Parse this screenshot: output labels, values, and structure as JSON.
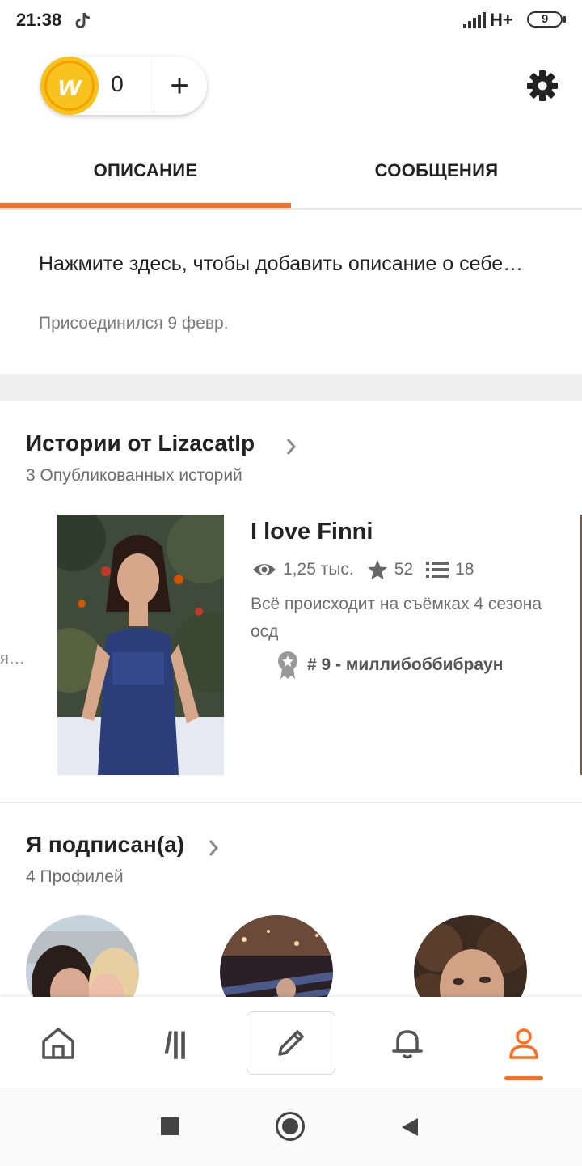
{
  "status_bar": {
    "time": "21:38",
    "network": "H+",
    "battery": "9"
  },
  "coins": {
    "count": "0",
    "add_label": "+",
    "coin_letter": "w"
  },
  "tabs": [
    {
      "label": "ОПИСАНИЕ",
      "selected": true
    },
    {
      "label": "СООБЩЕНИЯ",
      "selected": false
    }
  ],
  "profile": {
    "description_prompt": "Нажмите здесь, чтобы добавить описание о себе…",
    "joined": "Присоединился 9 февр."
  },
  "stories_section": {
    "title": "Истории от Lizacatlp",
    "count": "3 Опубликованных историй",
    "prev_card_text": "я…",
    "story": {
      "title": "I love Finni",
      "reads": "1,25 тыс.",
      "votes": "52",
      "parts": "18",
      "description": "Всё происходит на съёмках 4 сезона осд",
      "rank": "# 9 - миллибоббибраун"
    }
  },
  "following_section": {
    "title": "Я подписан(а)",
    "count": "4 Профилей"
  },
  "bottom_nav": {
    "library_glyph": "/||",
    "items": [
      "home-icon",
      "library-icon",
      "pencil-icon",
      "bell-icon",
      "profile-icon"
    ],
    "active": "profile-icon"
  },
  "colors": {
    "accent": "#ff6d1f",
    "text": "#222222",
    "muted": "#6d6d6d",
    "coin": "#f9c31f"
  }
}
